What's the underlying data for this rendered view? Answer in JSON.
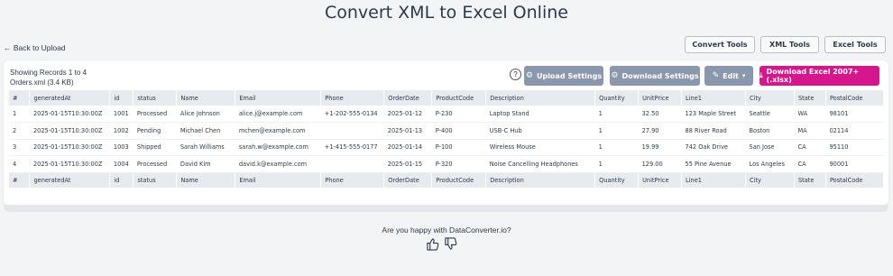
{
  "page": {
    "title": "Convert XML to Excel Online",
    "back_label": "Back to Upload"
  },
  "tools": [
    {
      "label": "Convert Tools"
    },
    {
      "label": "XML Tools"
    },
    {
      "label": "Excel Tools"
    }
  ],
  "records": {
    "showing": "Showing Records 1 to 4",
    "file": "Orders.xml (3.4 KB)"
  },
  "actions": {
    "help": "?",
    "upload_settings": "Upload Settings",
    "download_settings": "Download Settings",
    "edit": "Edit",
    "download_excel": "Download Excel 2007+ (.xlsx)"
  },
  "table": {
    "columns": [
      "#",
      "generatedAt",
      "id",
      "status",
      "Name",
      "Email",
      "Phone",
      "OrderDate",
      "ProductCode",
      "Description",
      "Quantity",
      "UnitPrice",
      "Line1",
      "City",
      "State",
      "PostalCode"
    ],
    "rows": [
      [
        "1",
        "2025-01-15T10:30:00Z",
        "1001",
        "Processed",
        "Alice Johnson",
        "alice.j@example.com",
        "+1-202-555-0134",
        "2025-01-12",
        "P-230",
        "Laptop Stand",
        "1",
        "32.50",
        "123 Maple Street",
        "Seattle",
        "WA",
        "98101"
      ],
      [
        "2",
        "2025-01-15T10:30:00Z",
        "1002",
        "Pending",
        "Michael Chen",
        "mchen@example.com",
        "",
        "2025-01-13",
        "P-400",
        "USB-C Hub",
        "1",
        "27.90",
        "88 River Road",
        "Boston",
        "MA",
        "02114"
      ],
      [
        "3",
        "2025-01-15T10:30:00Z",
        "1003",
        "Shipped",
        "Sarah Williams",
        "sarah.w@example.com",
        "+1-415-555-0177",
        "2025-01-14",
        "P-100",
        "Wireless Mouse",
        "1",
        "19.99",
        "742 Oak Drive",
        "San Jose",
        "CA",
        "95110"
      ],
      [
        "4",
        "2025-01-15T10:30:00Z",
        "1004",
        "Processed",
        "David Kim",
        "david.k@example.com",
        "",
        "2025-01-15",
        "P-320",
        "Noise Cancelling Headphones",
        "1",
        "129.00",
        "55 Pine Avenue",
        "Los Angeles",
        "CA",
        "90001"
      ]
    ]
  },
  "feedback": {
    "question": "Are you happy with DataConverter.io?"
  },
  "colors": {
    "accent_pink": "#d6168c",
    "button_grey": "#8b97ad",
    "header_bg": "#e7eaee"
  }
}
